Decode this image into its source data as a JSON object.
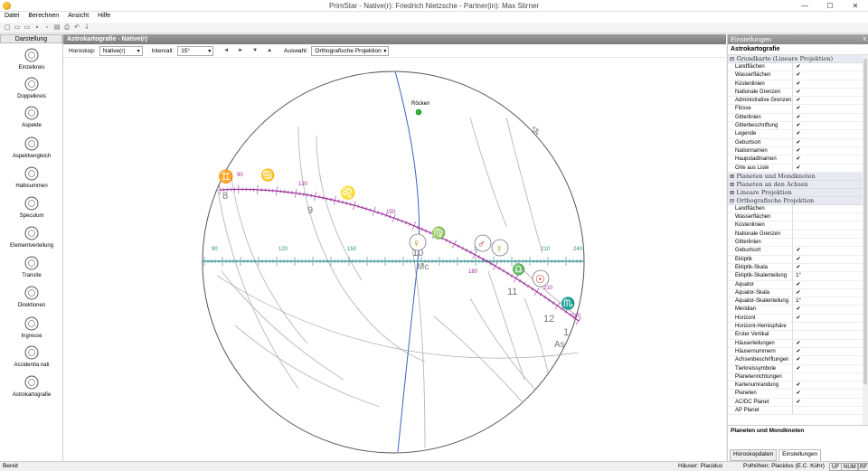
{
  "window": {
    "title": "PrimStar - Native(r): Friedrich Nietzsche - Partner(in): Max Stirner"
  },
  "menu": [
    "Datei",
    "Berechnen",
    "Ansicht",
    "Hilfe"
  ],
  "left": {
    "header": "Darstellung",
    "items": [
      {
        "label": "Einzelkreis",
        "icon": "single-circle-icon"
      },
      {
        "label": "Doppelkreis",
        "icon": "double-circle-icon"
      },
      {
        "label": "Aspekte",
        "icon": "aspects-icon"
      },
      {
        "label": "Aspektvergleich",
        "icon": "aspect-compare-icon"
      },
      {
        "label": "Halbsummen",
        "icon": "halfsum-icon"
      },
      {
        "label": "Speculum",
        "icon": "speculum-icon"
      },
      {
        "label": "Elementverteilung",
        "icon": "element-chart-icon"
      },
      {
        "label": "Transite",
        "icon": "transits-icon"
      },
      {
        "label": "Direktionen",
        "icon": "directions-icon"
      },
      {
        "label": "Ingresse",
        "icon": "ingress-icon"
      },
      {
        "label": "Accidentia nati",
        "icon": "accidentia-icon"
      },
      {
        "label": "Astrokartografie",
        "icon": "astrocartography-icon"
      }
    ]
  },
  "main": {
    "header": "Astrokartografie - Native(r)",
    "horoskop_label": "Horoskop:",
    "horoskop_value": "Native(r)",
    "intervall_label": "Intervall:",
    "intervall_value": "15°",
    "auswahl_label": "Auswahl:",
    "auswahl_value": "Orthografische Projektion",
    "nav": [
      "◄",
      "►",
      "▼",
      "▲"
    ],
    "globe": {
      "roecken": "Röcken",
      "mc": "Mc",
      "as": "As",
      "houses": [
        "8",
        "9",
        "10",
        "11",
        "12",
        "1"
      ],
      "equator_ticks": [
        "90",
        "120",
        "150",
        "180",
        "210",
        "240"
      ],
      "ecliptic_ticks": [
        "90",
        "120",
        "150",
        "180",
        "210",
        "240"
      ],
      "signs": [
        "♊",
        "♋",
        "♌",
        "♍",
        "♎",
        "♏"
      ],
      "planets": [
        "♀",
        "♂",
        "☿",
        "☉"
      ]
    }
  },
  "right": {
    "header": "Einstellungen",
    "close": "x",
    "sub": "Astrokartografie",
    "sections": [
      {
        "title": "⊟ Grundkarte (Lineare Projektion)",
        "rows": [
          [
            "Landflächen",
            "✔"
          ],
          [
            "Wasserflächen",
            "✔"
          ],
          [
            "Küstenlinien",
            "✔"
          ],
          [
            "Nationale Grenzen",
            "✔"
          ],
          [
            "Administrative Grenzen",
            "✔"
          ],
          [
            "Flüsse",
            "✔"
          ],
          [
            "Gitterlinien",
            "✔"
          ],
          [
            "Gitterbeschriftung",
            "✔"
          ],
          [
            "Legende",
            "✔"
          ],
          [
            "Geburtsort",
            "✔"
          ],
          [
            "Nationnamen",
            "✔"
          ],
          [
            "Haupstadtnamen",
            "✔"
          ],
          [
            "Orte aus Liste",
            "✔"
          ]
        ]
      },
      {
        "title": "⊞ Planeten und Mondknoten",
        "rows": []
      },
      {
        "title": "⊞ Planeten an den Achsen",
        "rows": []
      },
      {
        "title": "⊞ Lineare Projektion",
        "rows": []
      },
      {
        "title": "⊟ Orthografische Projektion",
        "rows": [
          [
            "Landflächen",
            ""
          ],
          [
            "Wasserflächen",
            ""
          ],
          [
            "Küstenlinien",
            ""
          ],
          [
            "Nationale Grenzen",
            ""
          ],
          [
            "Gitterlinien",
            ""
          ],
          [
            "Geburtsort",
            "✔"
          ],
          [
            "Ekliptik",
            "✔"
          ],
          [
            "Ekliptik-Skala",
            "✔"
          ],
          [
            "Ekliptik-Skalenteilung",
            "1°"
          ],
          [
            "Äquator",
            "✔"
          ],
          [
            "Äquator-Skala",
            "✔"
          ],
          [
            "Äquator-Skalenteilung",
            "1°"
          ],
          [
            "Meridian",
            "✔"
          ],
          [
            "Horizont",
            "✔"
          ],
          [
            "Horizont-Hemisphäre",
            ""
          ],
          [
            "Erster Vertikal",
            ""
          ],
          [
            "Häuserteilungen",
            "✔"
          ],
          [
            "Häusernummern",
            "✔"
          ],
          [
            "Achsenbeschriftungen",
            "✔"
          ],
          [
            "Tierkreissymbole",
            "✔"
          ],
          [
            "Planetenrichtungen",
            ""
          ],
          [
            "Kartenumrandung",
            "✔"
          ],
          [
            "Planeten",
            "✔"
          ],
          [
            "AC/DC Planet",
            "✔"
          ],
          [
            "AP Planet",
            ""
          ]
        ]
      }
    ],
    "info": "Planeten und Mondknoten",
    "tabs": [
      "Horoskopdaten",
      "Einstellungen"
    ]
  },
  "status": {
    "left": "Bereit",
    "houses": "Häuser: Placidus",
    "poles": "Polhöhen: Placidus (E.C. Kühr)",
    "uf": "UF",
    "num": "NUM",
    "rf": "RF"
  },
  "colors": {
    "ecliptic": "#9b2d9b",
    "equator": "#2a8a8a",
    "meridian": "#4060c0",
    "sign_red": "#c81818",
    "sign_blue": "#1f2e9a",
    "gold": "#b08a00"
  }
}
